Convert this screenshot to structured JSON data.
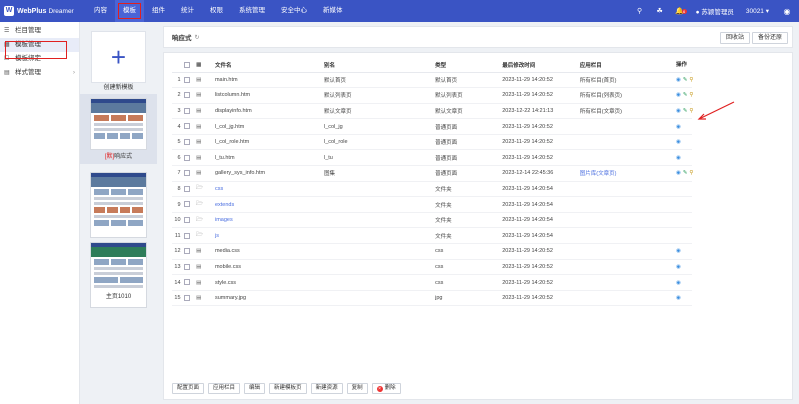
{
  "app": {
    "logo_mark": "W",
    "logo_name": "WebPlus",
    "logo_sub": "Dreamer"
  },
  "nav": [
    "内容",
    "模板",
    "组件",
    "统计",
    "权限",
    "系统管理",
    "安全中心",
    "新媒体"
  ],
  "nav_active_index": 1,
  "topright": {
    "notification_count": "6",
    "user": "苏颖管理员",
    "site_id": "30021"
  },
  "sidebar": {
    "items": [
      {
        "label": "栏目管理",
        "icon": "columns-icon"
      },
      {
        "label": "模板管理",
        "icon": "template-icon"
      },
      {
        "label": "模板绑定",
        "icon": "bind-icon"
      },
      {
        "label": "样式管理",
        "icon": "style-icon"
      }
    ]
  },
  "templates": {
    "create_label": "创建新模板",
    "items": [
      {
        "tag": "[默]",
        "name": "响应式"
      },
      {
        "tag": "",
        "name": ""
      },
      {
        "tag": "",
        "name": "主页1010"
      }
    ]
  },
  "header": {
    "title": "响应式",
    "recycle": "回收站",
    "backup": "备份还原"
  },
  "table": {
    "headers": [
      "文件名",
      "别名",
      "类型",
      "最后修改时间",
      "应用栏目",
      "操作"
    ],
    "rows": [
      {
        "num": "1",
        "kind": "file",
        "name": "main.htm",
        "alias": "默认首页",
        "type": "默认首页",
        "time": "2023-11-29 14:20:52",
        "column": "所有栏目(首页)",
        "column_link": false,
        "ops": [
          "view",
          "edit",
          "search"
        ]
      },
      {
        "num": "2",
        "kind": "file",
        "name": "listcolumn.htm",
        "alias": "默认列表页",
        "type": "默认列表页",
        "time": "2023-11-29 14:20:52",
        "column": "所有栏目(列表页)",
        "column_link": false,
        "ops": [
          "view",
          "edit",
          "search"
        ]
      },
      {
        "num": "3",
        "kind": "file",
        "name": "displayinfo.htm",
        "alias": "默认文章页",
        "type": "默认文章页",
        "time": "2023-12-22 14:21:13",
        "column": "所有栏目(文章页)",
        "column_link": false,
        "ops": [
          "view",
          "edit",
          "search"
        ]
      },
      {
        "num": "4",
        "kind": "file",
        "name": "l_col_jg.htm",
        "alias": "l_col_jg",
        "type": "普通页面",
        "time": "2023-11-29 14:20:52",
        "column": "",
        "column_link": false,
        "ops": [
          "view"
        ]
      },
      {
        "num": "5",
        "kind": "file",
        "name": "l_col_role.htm",
        "alias": "l_col_role",
        "type": "普通页面",
        "time": "2023-11-29 14:20:52",
        "column": "",
        "column_link": false,
        "ops": [
          "view"
        ]
      },
      {
        "num": "6",
        "kind": "file",
        "name": "l_tu.htm",
        "alias": "l_tu",
        "type": "普通页面",
        "time": "2023-11-29 14:20:52",
        "column": "",
        "column_link": false,
        "ops": [
          "view"
        ]
      },
      {
        "num": "7",
        "kind": "file",
        "name": "gallery_sys_info.htm",
        "alias": "图集",
        "type": "普通页面",
        "time": "2023-12-14 22:45:36",
        "column": "图片库(文章页)",
        "column_link": true,
        "ops": [
          "view",
          "edit",
          "search"
        ]
      },
      {
        "num": "8",
        "kind": "folder",
        "name": "css",
        "alias": "",
        "type": "文件夹",
        "time": "2023-11-29 14:20:54",
        "column": "",
        "column_link": false,
        "ops": []
      },
      {
        "num": "9",
        "kind": "folder",
        "name": "extends",
        "alias": "",
        "type": "文件夹",
        "time": "2023-11-29 14:20:54",
        "column": "",
        "column_link": false,
        "ops": []
      },
      {
        "num": "10",
        "kind": "folder",
        "name": "images",
        "alias": "",
        "type": "文件夹",
        "time": "2023-11-29 14:20:54",
        "column": "",
        "column_link": false,
        "ops": []
      },
      {
        "num": "11",
        "kind": "folder",
        "name": "js",
        "alias": "",
        "type": "文件夹",
        "time": "2023-11-29 14:20:54",
        "column": "",
        "column_link": false,
        "ops": []
      },
      {
        "num": "12",
        "kind": "file",
        "name": "media.css",
        "alias": "",
        "type": "css",
        "time": "2023-11-29 14:20:52",
        "column": "",
        "column_link": false,
        "ops": [
          "view"
        ]
      },
      {
        "num": "13",
        "kind": "file",
        "name": "mobile.css",
        "alias": "",
        "type": "css",
        "time": "2023-11-29 14:20:52",
        "column": "",
        "column_link": false,
        "ops": [
          "view"
        ]
      },
      {
        "num": "14",
        "kind": "file",
        "name": "style.css",
        "alias": "",
        "type": "css",
        "time": "2023-11-29 14:20:52",
        "column": "",
        "column_link": false,
        "ops": [
          "view"
        ]
      },
      {
        "num": "15",
        "kind": "file",
        "name": "summary.jpg",
        "alias": "",
        "type": "jpg",
        "time": "2023-11-29 14:20:52",
        "column": "",
        "column_link": false,
        "ops": [
          "view"
        ]
      }
    ]
  },
  "bottom_buttons": [
    "配置页面",
    "应用栏目",
    "编辑",
    "新建模板页",
    "新建资源",
    "复制",
    "删除"
  ],
  "colors": {
    "brand": "#3a54c4",
    "highlight": "#e02020",
    "link": "#4a6ee0"
  }
}
